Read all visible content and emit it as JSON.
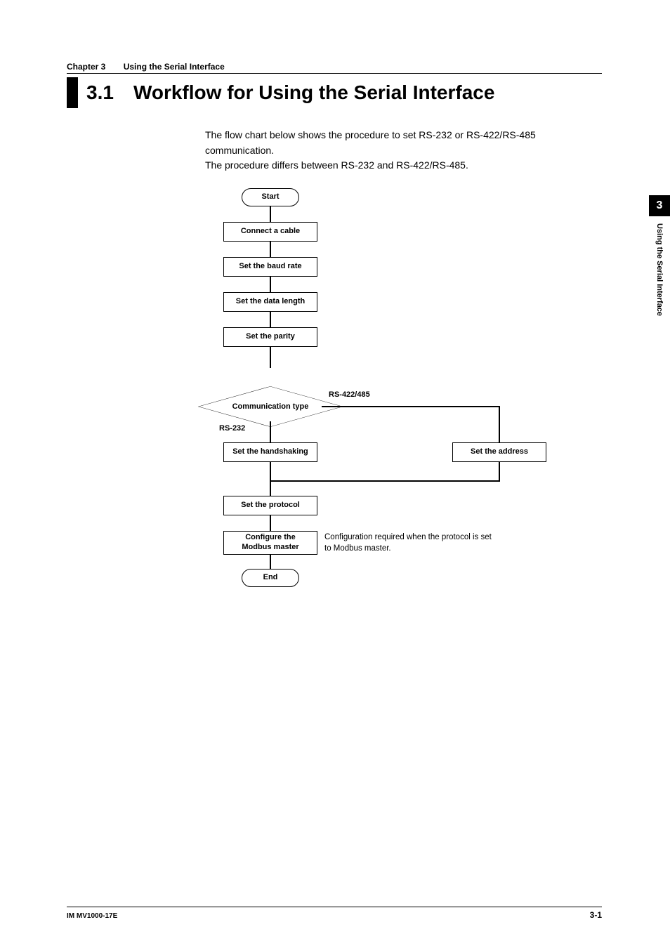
{
  "chapter": {
    "label": "Chapter 3",
    "title": "Using the Serial Interface"
  },
  "section": {
    "number": "3.1",
    "title": "Workflow for Using the Serial Interface"
  },
  "intro": {
    "line1": "The flow chart below shows the procedure to set RS-232 or RS-422/RS-485 communication.",
    "line2": "The procedure differs between RS-232 and RS-422/RS-485."
  },
  "flowchart": {
    "start": "Start",
    "connect": "Connect a cable",
    "baud": "Set the baud rate",
    "datalen": "Set the data length",
    "parity": "Set the parity",
    "commtype": "Communication type",
    "branch_left_label": "RS-232",
    "branch_right_label": "RS-422/485",
    "handshake": "Set the handshaking",
    "address": "Set the address",
    "protocol": "Set the protocol",
    "modbus": "Configure the\nModbus master",
    "modbus_note": "Configuration required when the protocol is set to Modbus master.",
    "end": "End"
  },
  "sidetab": {
    "number": "3",
    "text": "Using the Serial Interface"
  },
  "footer": {
    "left": "IM MV1000-17E",
    "right": "3-1"
  }
}
